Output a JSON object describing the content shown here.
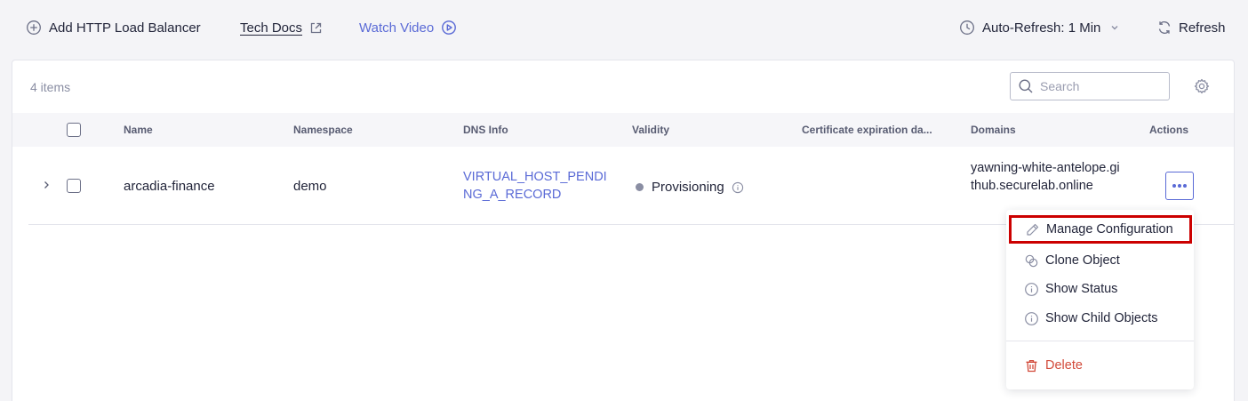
{
  "toolbar": {
    "add_label": "Add HTTP Load Balancer",
    "docs_label": "Tech Docs",
    "video_label": "Watch Video",
    "auto_refresh_label": "Auto-Refresh: 1 Min",
    "refresh_label": "Refresh"
  },
  "list": {
    "item_count": "4 items",
    "search_placeholder": "Search"
  },
  "table": {
    "columns": {
      "name": "Name",
      "namespace": "Namespace",
      "dns_info": "DNS Info",
      "validity": "Validity",
      "cert_expiration": "Certificate expiration da...",
      "domains": "Domains",
      "actions": "Actions"
    },
    "rows": [
      {
        "name": "arcadia-finance",
        "namespace": "demo",
        "dns_info": "VIRTUAL_HOST_PENDING_A_RECORD",
        "validity": "Provisioning",
        "cert_expiration": "",
        "domains": "yawning-white-antelope.github.securelab.online"
      }
    ]
  },
  "menu": {
    "items": [
      {
        "label": "Manage Configuration",
        "icon": "pencil-icon"
      },
      {
        "label": "Clone Object",
        "icon": "clone-icon"
      },
      {
        "label": "Show Status",
        "icon": "info-icon"
      },
      {
        "label": "Show Child Objects",
        "icon": "info-icon"
      },
      {
        "label": "Delete",
        "icon": "trash-icon"
      }
    ]
  },
  "colors": {
    "accent": "#5a6ad6",
    "danger": "#d24a3a",
    "highlight": "#cc0000"
  }
}
